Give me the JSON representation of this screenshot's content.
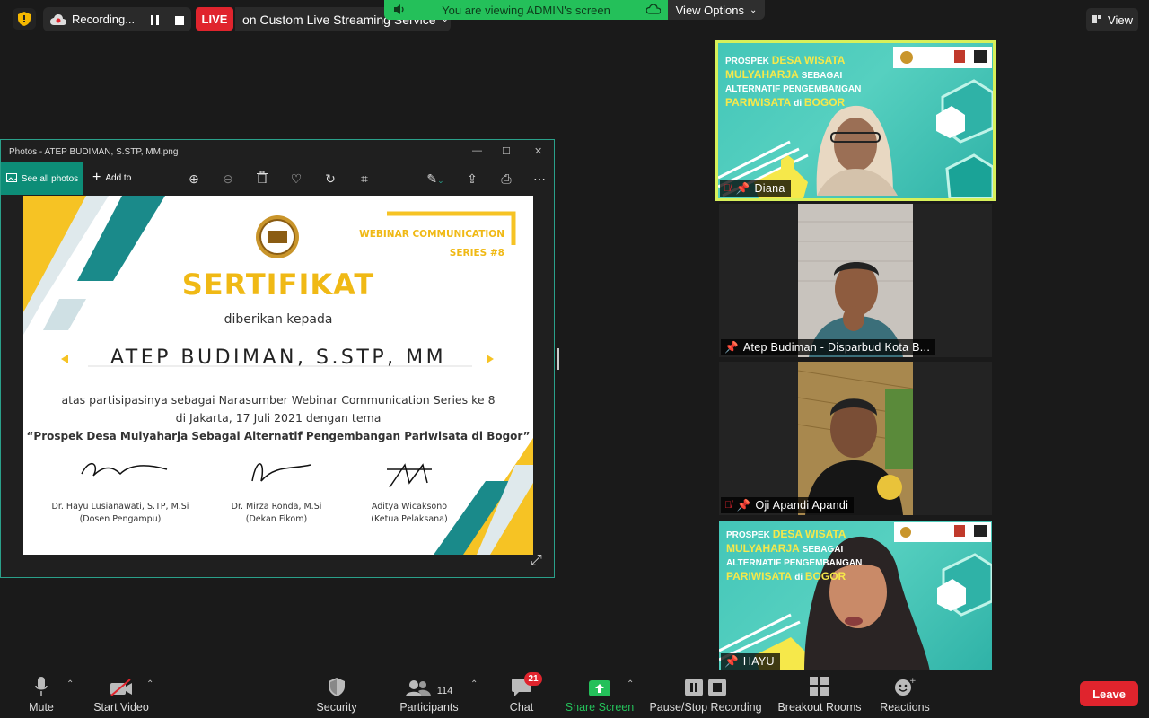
{
  "topbar": {
    "recording_label": "Recording...",
    "live_label": "LIVE",
    "stream_label": "on Custom Live Streaming Service",
    "viewing_label": "You are viewing ADMIN's screen",
    "view_options_label": "View Options",
    "view_label": "View"
  },
  "photos": {
    "title": "Photos - ATEP BUDIMAN, S.STP, MM.png",
    "see_all_label": "See all photos",
    "add_to_label": "Add to"
  },
  "certificate": {
    "series_line1": "WEBINAR COMMUNICATION",
    "series_line2": "SERIES #8",
    "heading": "SERTIFIKAT",
    "given_to": "diberikan kepada",
    "recipient": "ATEP BUDIMAN, S.STP, MM",
    "line1": "atas partisipasinya sebagai Narasumber Webinar Communication Series ke 8",
    "line2": "di Jakarta, 17 Juli 2021  dengan tema",
    "theme": "“Prospek Desa Mulyaharja Sebagai Alternatif  Pengembangan Pariwisata di Bogor”",
    "signers": [
      {
        "name": "Dr. Hayu Lusianawati, S.TP, M.Si",
        "role": "(Dosen Pengampu)"
      },
      {
        "name": "Dr. Mirza Ronda, M.Si",
        "role": "(Dekan Fikom)"
      },
      {
        "name": "Aditya Wicaksono",
        "role": "(Ketua Pelaksana)"
      }
    ]
  },
  "slide": {
    "line1a": "PROSPEK ",
    "line1b": "DESA WISATA",
    "line2a": "MULYAHARJA ",
    "line2b": "SEBAGAI",
    "line3": "ALTERNATIF PENGEMBANGAN",
    "line4a": "PARIWISATA ",
    "line4b": "di ",
    "line4c": "BOGOR"
  },
  "participants": [
    {
      "name": "Diana"
    },
    {
      "name": "Atep Budiman - Disparbud Kota B..."
    },
    {
      "name": "Oji Apandi Apandi"
    },
    {
      "name": "HAYU"
    }
  ],
  "bottombar": {
    "mute": "Mute",
    "start_video": "Start Video",
    "security": "Security",
    "participants": "Participants",
    "participants_count": "114",
    "chat": "Chat",
    "chat_badge": "21",
    "share_screen": "Share Screen",
    "pause_stop": "Pause/Stop Recording",
    "breakout": "Breakout Rooms",
    "reactions": "Reactions",
    "leave": "Leave"
  },
  "colors": {
    "accent_green": "#24c05a",
    "leave_red": "#e0242d",
    "cert_yellow": "#f6c324",
    "cert_teal": "#1a8a8a"
  }
}
